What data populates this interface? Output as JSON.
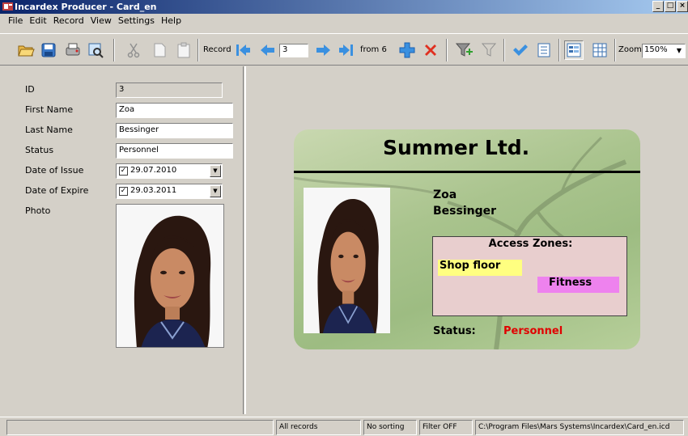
{
  "window": {
    "title": "Incardex Producer - Card_en",
    "minimize": "_",
    "maximize": "□",
    "close": "×"
  },
  "menu": [
    "File",
    "Edit",
    "Record",
    "View",
    "Settings",
    "Help"
  ],
  "toolbar": {
    "record_label": "Record",
    "record_value": "3",
    "from_label": "from 6",
    "zoom_label": "Zoom",
    "zoom_value": "150%"
  },
  "form": {
    "id_label": "ID",
    "id_value": "3",
    "first_label": "First Name",
    "first_value": "Zoa",
    "last_label": "Last Name",
    "last_value": "Bessinger",
    "status_label": "Status",
    "status_value": "Personnel",
    "issue_label": "Date of Issue",
    "issue_value": "29.07.2010",
    "expire_label": "Date of Expire",
    "expire_value": "29.03.2011",
    "photo_label": "Photo"
  },
  "card": {
    "company": "Summer Ltd.",
    "first_name": "Zoa",
    "last_name": "Bessinger",
    "zones_title": "Access Zones:",
    "zone_1": "Shop floor",
    "zone_2": "Fitness",
    "status_label": "Status:",
    "status_value": "Personnel",
    "colors": {
      "zone_1": "#ffff80",
      "zone_2": "#ee82ee",
      "status": "#e00000"
    }
  },
  "statusbar": {
    "pane1": "",
    "records": "All records",
    "sorting": "No sorting",
    "filter": "Filter OFF",
    "path": "C:\\Program Files\\Mars Systems\\Incardex\\Card_en.icd"
  }
}
